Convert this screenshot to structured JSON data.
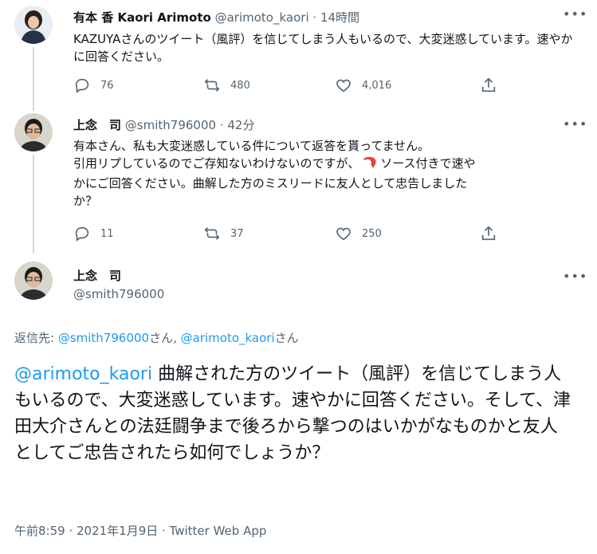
{
  "tweets": [
    {
      "name": "有本 香 Kaori Arimoto",
      "handle": "@arimoto_kaori",
      "time": "· 14時間",
      "text": "KAZUYAさんのツイート（風評）を信じてしまう人もいるので、大変迷惑しています。速やかに回答ください。",
      "replies": "76",
      "retweets": "480",
      "likes": "4,016"
    },
    {
      "name": "上念　司",
      "handle": "@smith796000",
      "time": "· 42分",
      "text_line1": "有本さん、私も大変迷惑している件について返答を貰ってません。",
      "text_line2a": "引用リプしているのでご存知ないわけないのですが、",
      "text_line2b": "ソース付きで速や",
      "text_line3": "かにご回答ください。曲解した方のミスリードに友人として忠告しました",
      "text_line4": "か？",
      "replies": "11",
      "retweets": "37",
      "likes": "250"
    }
  ],
  "main_tweet": {
    "name": "上念　司",
    "handle": "@smith796000",
    "reply_to_label": "返信先: ",
    "reply_to_1": "@smith796000",
    "reply_to_sep": "さん, ",
    "reply_to_2": "@arimoto_kaori",
    "reply_to_suffix": "さん",
    "mention": "@arimoto_kaori",
    "text": " 曲解された方のツイート（風評）を信じてしまう人もいるので、大変迷惑しています。速やかに回答ください。そして、津田大介さんとの法廷闘争まで後ろから撃つのはいかがなものかと友人としてご忠告されたら如何でしょうか？",
    "timestamp": "午前8:59 · 2021年1月9日 · Twitter Web App"
  },
  "icons": [
    "more-icon",
    "reply-icon",
    "retweet-icon",
    "like-icon",
    "share-icon",
    "shrimp-emoji"
  ]
}
